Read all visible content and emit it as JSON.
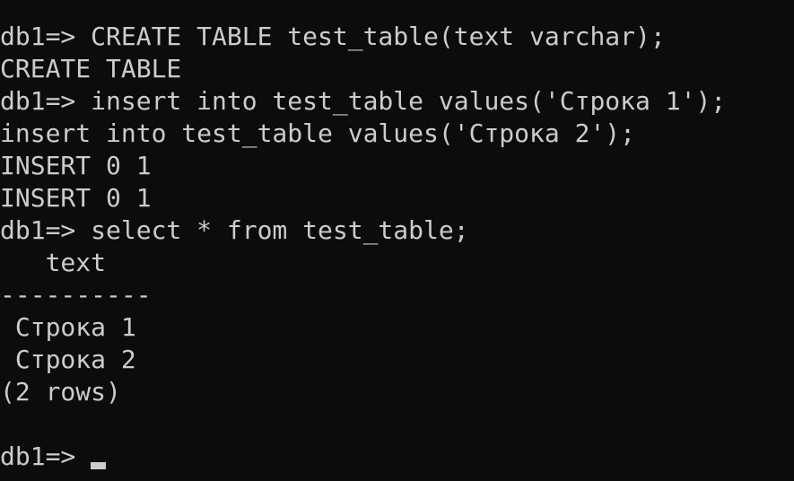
{
  "terminal": {
    "lines": [
      "db1=> CREATE TABLE test_table(text varchar);",
      "CREATE TABLE",
      "db1=> insert into test_table values('Строка 1');",
      "insert into test_table values('Строка 2');",
      "INSERT 0 1",
      "INSERT 0 1",
      "db1=> select * from test_table;",
      "   text",
      "----------",
      " Строка 1",
      " Строка 2",
      "(2 rows)",
      ""
    ],
    "prompt": "db1=> "
  },
  "colors": {
    "background": "#0c0c0c",
    "text": "#cccccc"
  }
}
